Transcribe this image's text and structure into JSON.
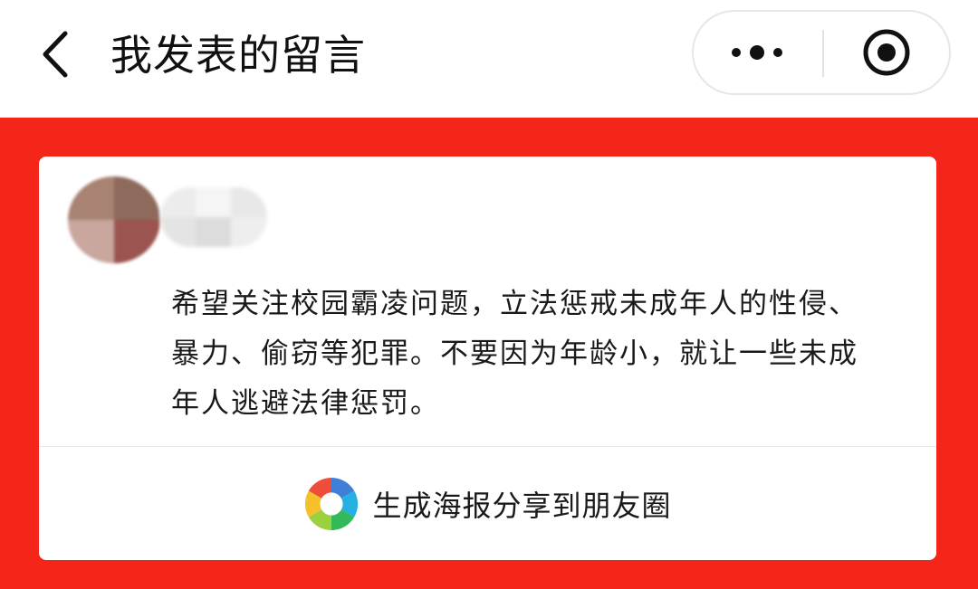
{
  "nav": {
    "back_icon": "chevron-left-icon",
    "title": "我发表的留言",
    "more_icon": "more-dots-icon",
    "close_icon": "target-circle-icon"
  },
  "comment": {
    "avatar": "blurred-avatar",
    "nickname": "blurred-nickname",
    "text": "希望关注校园霸凌问题，立法惩戒未成年人的性侵、暴力、偷窃等犯罪。不要因为年龄小，就让一些未成年人逃避法律惩罚。"
  },
  "share": {
    "icon": "aperture-icon",
    "label": "生成海报分享到朋友圈"
  },
  "colors": {
    "banner": "#f4261a",
    "card": "#ffffff",
    "nav": "#ffffff",
    "text": "#1a1a1a"
  }
}
